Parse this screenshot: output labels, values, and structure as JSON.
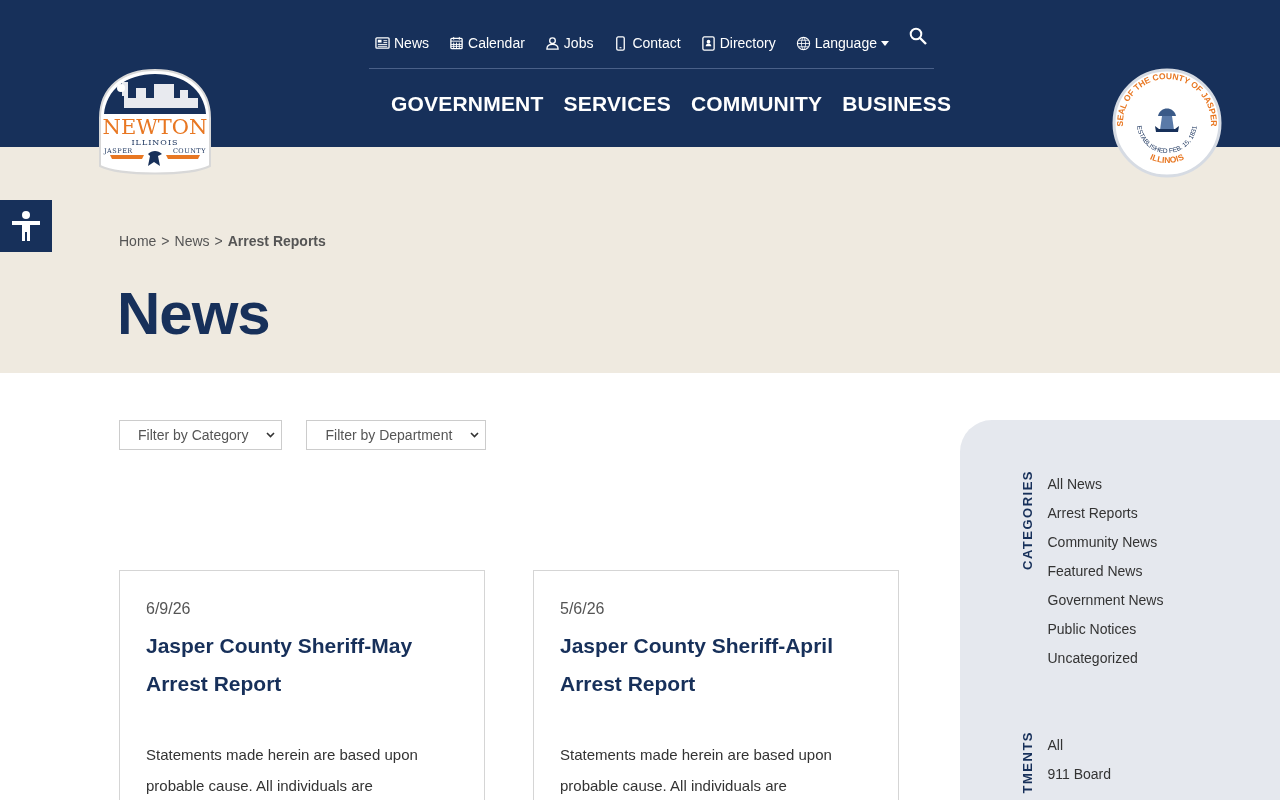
{
  "top_nav": [
    {
      "label": "News",
      "kind": "link"
    },
    {
      "label": "Calendar",
      "kind": "link"
    },
    {
      "label": "Jobs",
      "kind": "link"
    },
    {
      "label": "Contact",
      "kind": "link"
    },
    {
      "label": "Directory",
      "kind": "link"
    },
    {
      "label": "Language",
      "kind": "dropdown"
    }
  ],
  "main_nav": [
    "GOVERNMENT",
    "SERVICES",
    "COMMUNITY",
    "BUSINESS"
  ],
  "logo": {
    "name": "NEWTON",
    "state": "ILLINOIS",
    "left_word": "JASPER",
    "right_word": "COUNTY"
  },
  "seal": {
    "top": "SEAL OF THE COUNTY OF JASPER",
    "middle": "ESTABLISHED FEB. 15, 1831",
    "bottom": "ILLINOIS"
  },
  "breadcrumb": [
    {
      "label": "Home",
      "current": false
    },
    {
      "label": "News",
      "current": false
    },
    {
      "label": "Arrest Reports",
      "current": true
    }
  ],
  "breadcrumb_separator": ">",
  "page_title": "News",
  "filters": [
    {
      "label": "Filter by Category"
    },
    {
      "label": "Filter by Department"
    }
  ],
  "posts": [
    {
      "date": "6/9/26",
      "title": "Jasper County Sheriff-May Arrest Report",
      "excerpt": "Statements made herein are based upon probable cause. All individuals are"
    },
    {
      "date": "5/6/26",
      "title": "Jasper County Sheriff-April Arrest Report",
      "excerpt": "Statements made herein are based upon probable cause. All individuals are"
    }
  ],
  "sidebar": [
    {
      "heading": "CATEGORIES",
      "items": [
        "All News",
        "Arrest Reports",
        "Community News",
        "Featured News",
        "Government News",
        "Public Notices",
        "Uncategorized"
      ]
    },
    {
      "heading": "TMENTS",
      "items": [
        "All",
        "911 Board"
      ]
    }
  ]
}
